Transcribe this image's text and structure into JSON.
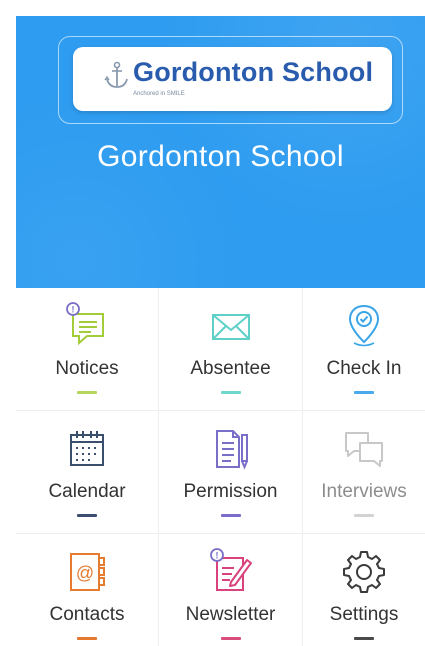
{
  "header": {
    "logo_text": "Gordonton School",
    "logo_tagline": "Anchored in SMILE",
    "school_name": "Gordonton School",
    "background_color": "#2e9cf0"
  },
  "tiles": [
    {
      "label": "Notices",
      "icon": "notices-icon",
      "color": "#a3cc3b",
      "bar_color": "#b5d65a",
      "badge": "!"
    },
    {
      "label": "Absentee",
      "icon": "envelope-icon",
      "color": "#5fd0c8",
      "bar_color": "#6fd6cc"
    },
    {
      "label": "Check In",
      "icon": "location-pin-icon",
      "color": "#3aa5e8",
      "bar_color": "#4aa9ea"
    },
    {
      "label": "Calendar",
      "icon": "calendar-icon",
      "color": "#3a4f6e",
      "bar_color": "#3c4e70"
    },
    {
      "label": "Permission",
      "icon": "permission-icon",
      "color": "#7a6fc8",
      "bar_color": "#7b6cc9"
    },
    {
      "label": "Interviews",
      "icon": "chat-bubbles-icon",
      "color": "#c8c8c8",
      "bar_color": "#d3d3d3"
    },
    {
      "label": "Contacts",
      "icon": "address-book-icon",
      "color": "#e47b2e",
      "bar_color": "#e57a2e"
    },
    {
      "label": "Newsletter",
      "icon": "newsletter-icon",
      "color": "#d9437d",
      "bar_color": "#d94c7e",
      "badge": "!"
    },
    {
      "label": "Settings",
      "icon": "gear-icon",
      "color": "#3a3a3a",
      "bar_color": "#4a4a4a"
    }
  ]
}
